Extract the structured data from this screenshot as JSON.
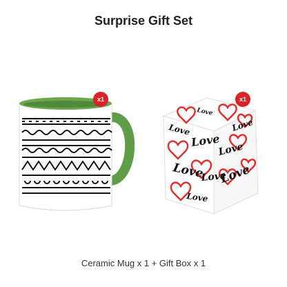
{
  "title": "Surprise Gift Set",
  "caption": "Ceramic Mug x 1 + Gift Box x 1",
  "products": [
    {
      "name": "ceramic-mug",
      "quantity_badge": "x1",
      "rim_color": "#6aa84f"
    },
    {
      "name": "gift-box",
      "quantity_badge": "x1",
      "print_text": "Love"
    }
  ],
  "colors": {
    "badge": "#d8232a",
    "handle": "#5f9e47"
  }
}
